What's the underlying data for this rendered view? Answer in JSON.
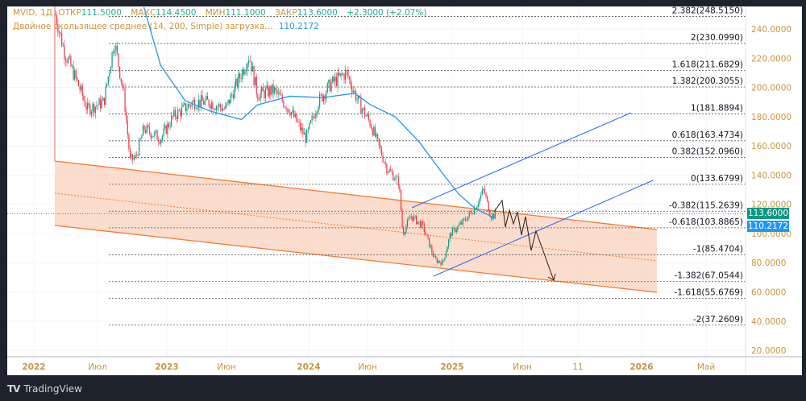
{
  "legend": {
    "symbol": "MVID, 1Д",
    "open_label": "ОТКР",
    "open": "111.5000",
    "high_label": "МАКС",
    "high": "114.4500",
    "low_label": "МИН",
    "low": "111.1000",
    "close_label": "ЗАКР",
    "close": "113.6000",
    "change": "+2.3000 (+2.07%)",
    "indicator": "Двойное скользящее среднее (14, 200, Simple) загрузка...",
    "indicator_value": "110.2172"
  },
  "price_badges": {
    "last": "113.6000",
    "ma": "110.2172"
  },
  "colors": {
    "up": "#089981",
    "down": "#f23645",
    "ma": "#2196f3",
    "channel": "#f57c32",
    "channel_fill": "#f8d2bc",
    "axis_text": "#c8963e",
    "last_price": "#089981",
    "trendline": "#2962ff",
    "projection": "#2a1e14"
  },
  "brand": "TradingView",
  "chart_data": {
    "type": "candlestick",
    "symbol": "MVID",
    "interval": "1D",
    "y_axis": {
      "ticks": [
        "240.0000",
        "220.0000",
        "200.0000",
        "180.0000",
        "160.0000",
        "140.0000",
        "120.0000",
        "100.0000",
        "80.0000",
        "60.0000",
        "40.0000",
        "20.0000"
      ],
      "range": [
        14,
        262
      ]
    },
    "x_axis": {
      "ticks": [
        "2022",
        "Июл",
        "2023",
        "Июн",
        "2024",
        "Июн",
        "2025",
        "Июн",
        "11",
        "2026",
        "Май"
      ]
    },
    "price_path": [
      [
        "2022-03-01",
        250
      ],
      [
        "2022-03-25",
        225
      ],
      [
        "2022-05-06",
        200
      ],
      [
        "2022-05-28",
        185
      ],
      [
        "2022-07-12",
        190
      ],
      [
        "2022-08-10",
        232
      ],
      [
        "2022-09-05",
        195
      ],
      [
        "2022-09-22",
        150
      ],
      [
        "2022-10-08",
        152
      ],
      [
        "2022-10-30",
        172
      ],
      [
        "2022-12-15",
        165
      ],
      [
        "2023-01-17",
        180
      ],
      [
        "2023-03-10",
        190
      ],
      [
        "2023-04-20",
        190
      ],
      [
        "2023-06-01",
        185
      ],
      [
        "2023-07-12",
        210
      ],
      [
        "2023-08-01",
        222
      ],
      [
        "2023-08-22",
        195
      ],
      [
        "2023-10-03",
        198
      ],
      [
        "2023-11-13",
        185
      ],
      [
        "2023-12-25",
        165
      ],
      [
        "2024-01-25",
        190
      ],
      [
        "2024-02-25",
        202
      ],
      [
        "2024-04-06",
        210
      ],
      [
        "2024-05-07",
        190
      ],
      [
        "2024-06-07",
        175
      ],
      [
        "2024-07-18",
        145
      ],
      [
        "2024-08-18",
        135
      ],
      [
        "2024-08-28",
        100
      ],
      [
        "2024-09-18",
        112
      ],
      [
        "2024-10-18",
        105
      ],
      [
        "2024-11-18",
        82
      ],
      [
        "2024-12-08",
        80
      ],
      [
        "2024-12-28",
        100
      ],
      [
        "2025-01-25",
        108
      ],
      [
        "2025-02-20",
        118
      ],
      [
        "2025-03-10",
        130
      ],
      [
        "2025-03-25",
        112
      ],
      [
        "2025-04-05",
        113.6
      ]
    ],
    "ma_series": [
      [
        "2022-10-30",
        255
      ],
      [
        "2022-12-15",
        215
      ],
      [
        "2023-02-17",
        191
      ],
      [
        "2023-04-20",
        184
      ],
      [
        "2023-07-12",
        178
      ],
      [
        "2023-08-22",
        188
      ],
      [
        "2023-11-13",
        194
      ],
      [
        "2024-02-05",
        193
      ],
      [
        "2024-04-27",
        196
      ],
      [
        "2024-06-07",
        188
      ],
      [
        "2024-08-08",
        180
      ],
      [
        "2024-10-08",
        163
      ],
      [
        "2024-12-08",
        141
      ],
      [
        "2025-01-15",
        127
      ],
      [
        "2025-02-20",
        117
      ],
      [
        "2025-04-05",
        110.2172
      ]
    ],
    "last_price": 113.6,
    "fib_levels": [
      {
        "label": "2.382(248.5150)",
        "price": 248.515
      },
      {
        "label": "2(230.0990)",
        "price": 230.099
      },
      {
        "label": "1.618(211.6829)",
        "price": 211.6829
      },
      {
        "label": "1.382(200.3055)",
        "price": 200.3055
      },
      {
        "label": "1(181.8894)",
        "price": 181.8894
      },
      {
        "label": "0.618(163.4734)",
        "price": 163.4734
      },
      {
        "label": "0.382(152.0960)",
        "price": 152.096
      },
      {
        "label": "0(133.6799)",
        "price": 133.6799
      },
      {
        "label": "-0.382(115.2639)",
        "price": 115.2639
      },
      {
        "label": "-0.618(103.8865)",
        "price": 103.8865
      },
      {
        "label": "-1(85.4704)",
        "price": 85.4704
      },
      {
        "label": "-1.382(67.0544)",
        "price": 67.0544
      },
      {
        "label": "-1.618(55.6769)",
        "price": 55.6769
      },
      {
        "label": "-2(37.2609)",
        "price": 37.2609
      }
    ]
  }
}
